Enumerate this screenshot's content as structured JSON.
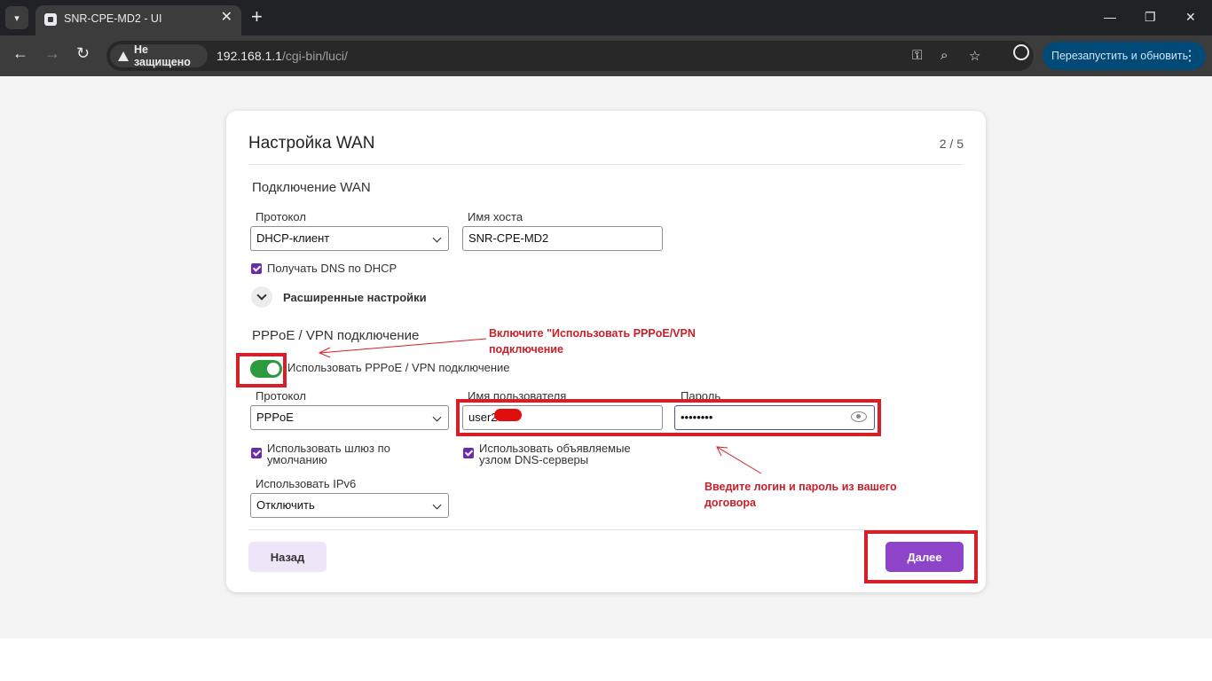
{
  "browser": {
    "tab_title": "SNR-CPE-MD2 - UI",
    "security_label": "Не защищено",
    "url_host": "192.168.1.1",
    "url_path": "/cgi-bin/luci/",
    "relaunch_label": "Перезапустить и обновить"
  },
  "wizard": {
    "title": "Настройка WAN",
    "step": "2 / 5",
    "wan": {
      "section_title": "Подключение WAN",
      "protocol_label": "Протокол",
      "protocol_value": "DHCP-клиент",
      "hostname_label": "Имя хоста",
      "hostname_value": "SNR-CPE-MD2",
      "dns_checkbox_label": "Получать DNS по DHCP",
      "advanced_label": "Расширенные настройки"
    },
    "pppoe": {
      "section_title": "PPPoE / VPN подключение",
      "toggle_label": "Использовать PPPoE / VPN подключение",
      "protocol_label": "Протокол",
      "protocol_value": "PPPoE",
      "username_label": "Имя пользователя",
      "username_value": "user2",
      "password_label": "Пароль",
      "password_value": "••••••••",
      "gateway_label_1": "Использовать шлюз по",
      "gateway_label_2": "умолчанию",
      "peer_dns_label_1": "Использовать объявляемые",
      "peer_dns_label_2": "узлом DNS-серверы",
      "ipv6_label": "Использовать IPv6",
      "ipv6_value": "Отключить"
    },
    "buttons": {
      "back": "Назад",
      "next": "Далее"
    }
  },
  "annotations": {
    "note_toggle_1": "Включите \"Использовать PPPoE/VPN",
    "note_toggle_2": "подключение",
    "note_creds_1": "Введите логин и пароль из вашего",
    "note_creds_2": "договора",
    "accent_color": "#d61f26"
  },
  "colors": {
    "primary": "#8e44c9",
    "checkbox": "#6b2bb0",
    "toggle_on": "#2e9a3e"
  }
}
